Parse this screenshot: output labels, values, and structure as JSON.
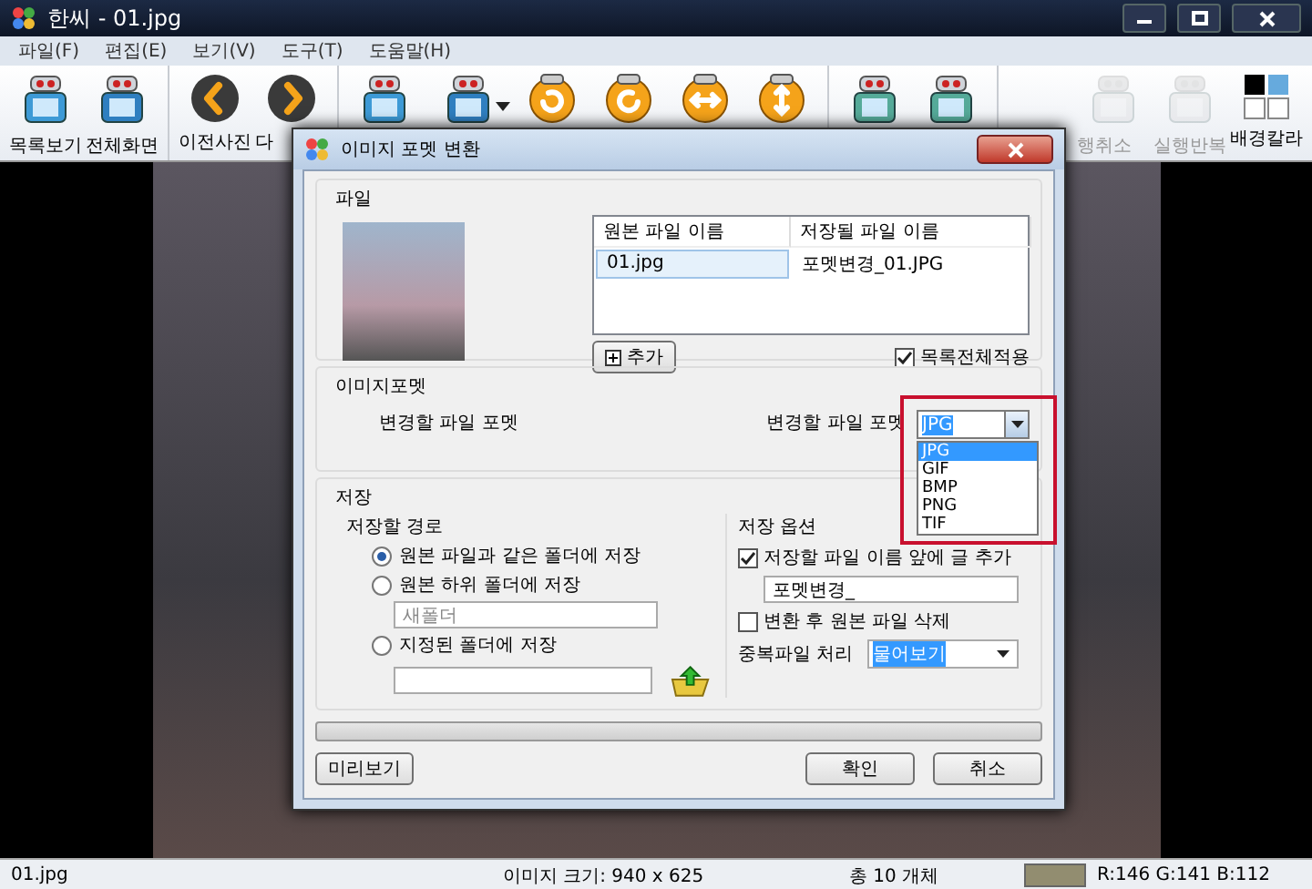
{
  "window": {
    "title": "한씨 - 01.jpg"
  },
  "menu": [
    "파일(F)",
    "편집(E)",
    "보기(V)",
    "도구(T)",
    "도움말(H)"
  ],
  "toolbar": [
    [
      {
        "label": "목록보기",
        "disabled": false
      },
      {
        "label": "전체화면",
        "disabled": false
      }
    ],
    [
      {
        "label": "이전사진",
        "disabled": false
      },
      {
        "label": "다",
        "disabled": false
      }
    ],
    [
      {
        "disabled": false
      },
      {
        "disabled": false,
        "dropdown": true
      },
      {
        "disabled": false
      },
      {
        "disabled": false
      },
      {
        "disabled": false
      },
      {
        "disabled": false
      }
    ],
    [
      {
        "disabled": false
      },
      {
        "disabled": false
      }
    ],
    [
      {
        "label": "행취소",
        "disabled": true
      },
      {
        "label": "실행반복",
        "disabled": true
      },
      {
        "label": "배경칼라",
        "disabled": false
      }
    ]
  ],
  "dialog": {
    "title": "이미지 포멧 변환",
    "file_group": {
      "title": "파일",
      "columns": [
        "원본 파일 이름",
        "저장될 파일 이름"
      ],
      "rows": [
        {
          "original": "01.jpg",
          "saved": "포멧변경_01.JPG",
          "selected": true
        }
      ],
      "add_button": "추가",
      "apply_all": {
        "label": "목록전체적용",
        "checked": true
      }
    },
    "format_group": {
      "title": "이미지포멧",
      "left_label": "변경할 파일 포멧",
      "format_label": "변경할 파일 포멧",
      "value": "JPG",
      "options": [
        {
          "label": "JPG",
          "selected": true
        },
        {
          "label": "GIF",
          "selected": false
        },
        {
          "label": "BMP",
          "selected": false
        },
        {
          "label": "PNG",
          "selected": false
        },
        {
          "label": "TIF",
          "selected": false
        }
      ]
    },
    "save_group": {
      "title": "저장",
      "path": {
        "title": "저장할 경로",
        "radios": [
          {
            "label": "원본 파일과 같은 폴더에 저장",
            "selected": true
          },
          {
            "label": "원본 하위 폴더에 저장",
            "selected": false
          },
          {
            "label": "지정된 폴더에 저장",
            "selected": false
          }
        ],
        "subfolder": {
          "value": "새폴더",
          "disabled": true
        }
      },
      "options": {
        "title": "저장 옵션",
        "prefix": {
          "label": "저장할 파일 이름 앞에 글 추가",
          "checked": true
        },
        "prefix_value": "포멧변경_",
        "delete_original": {
          "label": "변환 후 원본 파일 삭제",
          "checked": false
        },
        "duplicate_label": "중복파일 처리",
        "duplicate_value": "물어보기"
      }
    },
    "progress": {
      "level": 0
    },
    "buttons": {
      "preview": "미리보기",
      "ok": "확인",
      "cancel": "취소"
    }
  },
  "status_bar": {
    "file": "01.jpg",
    "size": "이미지 크기: 940 x 625",
    "count": "총 10 개체",
    "color": "#928d70",
    "rgb": "R:146 G:141 B:112"
  }
}
